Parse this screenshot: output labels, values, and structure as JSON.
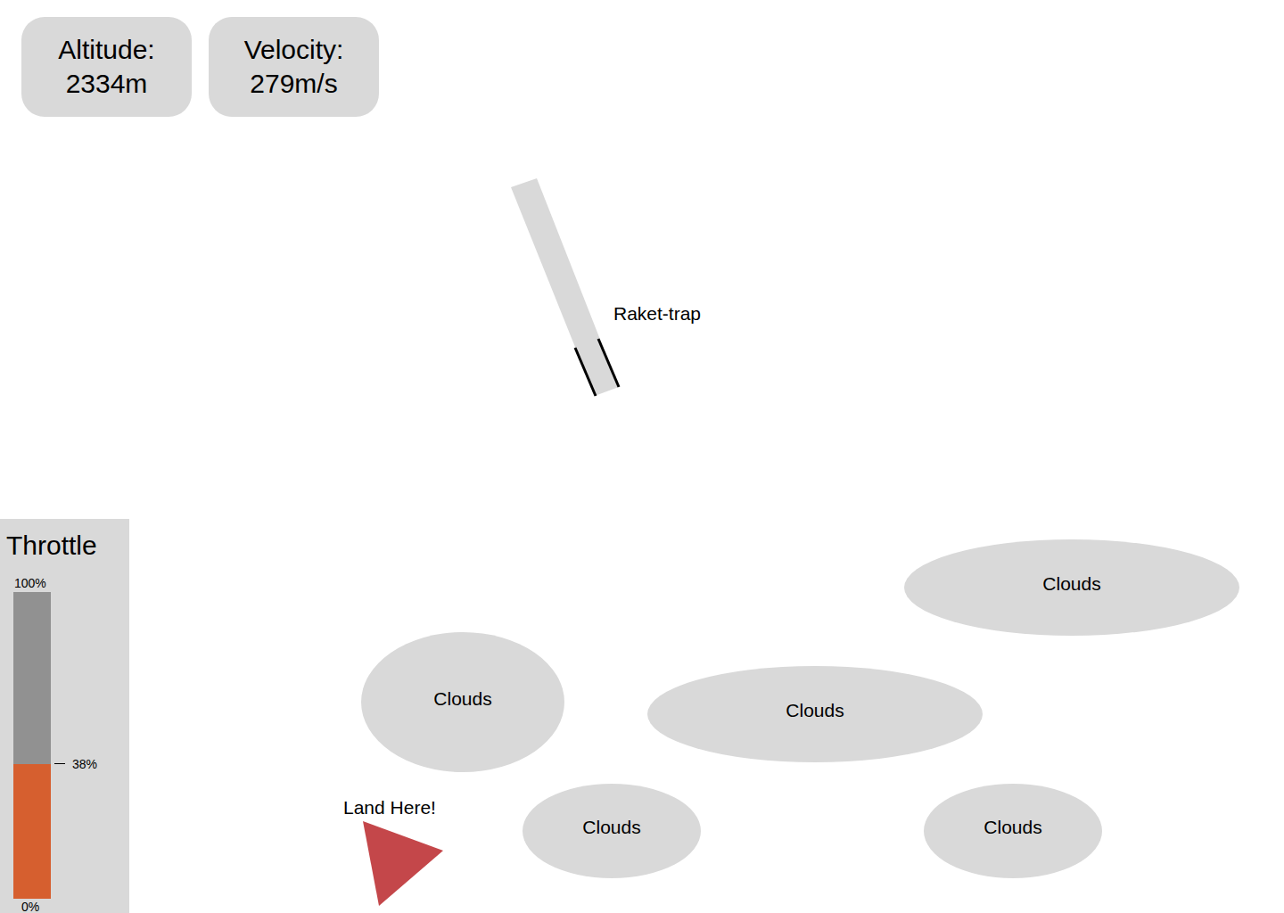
{
  "hud": [
    {
      "label": "Altitude:",
      "value": "2334m"
    },
    {
      "label": "Velocity:",
      "value": "279m/s"
    }
  ],
  "rocket": {
    "label": "Raket-trap"
  },
  "throttle": {
    "title": "Throttle",
    "max": "100%",
    "min": "0%",
    "reading": "38%",
    "level": 0.44
  },
  "clouds": [
    {
      "label": "Clouds"
    },
    {
      "label": "Clouds"
    },
    {
      "label": "Clouds"
    },
    {
      "label": "Clouds"
    },
    {
      "label": "Clouds"
    }
  ],
  "landing": {
    "label": "Land Here!"
  }
}
